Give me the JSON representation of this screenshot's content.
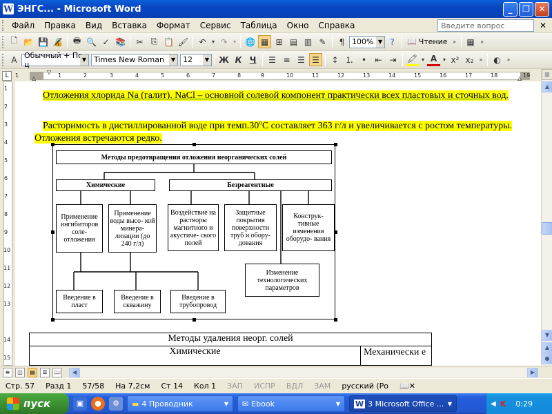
{
  "window": {
    "title": "ЭНГС... - Microsoft Word"
  },
  "menu": {
    "items": [
      "Файл",
      "Правка",
      "Вид",
      "Вставка",
      "Формат",
      "Сервис",
      "Таблица",
      "Окно",
      "Справка"
    ],
    "ask_placeholder": "Введите вопрос"
  },
  "toolbar_standard": {
    "zoom": "100%",
    "read_label": "Чтение"
  },
  "toolbar_format": {
    "style": "Обычный + По ц",
    "font": "Times New Roman",
    "size": "12",
    "bold": "Ж",
    "italic": "К",
    "underline": "Ч"
  },
  "ruler": {
    "ticks": [
      "1",
      "2",
      "1",
      "2",
      "3",
      "4",
      "5",
      "6",
      "7",
      "8",
      "9",
      "10",
      "11",
      "12",
      "13",
      "14",
      "15",
      "16",
      "17",
      "18",
      "19"
    ]
  },
  "vruler": {
    "ticks": [
      "1",
      "2",
      "3",
      "4",
      "5",
      "6",
      "7",
      "8",
      "9",
      "10",
      "11",
      "12",
      "13",
      "14",
      "15"
    ]
  },
  "document": {
    "para1": "Отложения хлорида Na (галит). NaCl – основной солевой компонент практически всех пластовых и сточных вод.",
    "para2_a": "Расторимость в дистиллированной воде при темп.30",
    "para2_sup": "o",
    "para2_b": "C составляет 363 г/л и увеличивается с ростом температуры. Отложения встречаются редко.",
    "figure": {
      "title": "Методы предотвращения отложения неорганических солей",
      "chem": "Химические",
      "nonreagent": "Безреагентные",
      "n1": "Применение ингибиторов соле- отложения",
      "n2": "Применение воды высо- кой минера- лизации (до 240 г/л)",
      "n3": "Воздействие на растворы магнитного и акустиче- ского полей",
      "n4": "Защитные покрытия поверхности труб и обору- дования",
      "n5": "Конструк- тивные изменения оборудо- вания",
      "n6": "Изменение технологических параметров",
      "n7": "Введение в пласт",
      "n8": "Введение в скважину",
      "n9": "Введение в трубопровод"
    },
    "table": {
      "header": "Методы удаления неорг. солей",
      "col1": "Химические",
      "col2": "Механически е"
    }
  },
  "statusbar": {
    "page": "Стр. 57",
    "section": "Разд 1",
    "pages": "57/58",
    "at": "На 7,2см",
    "line": "Ст 14",
    "col": "Кол 1",
    "rec": "ЗАП",
    "trk": "ИСПР",
    "ext": "ВДЛ",
    "ovr": "ЗАМ",
    "lang": "русский (Ро"
  },
  "taskbar": {
    "start": "пуск",
    "tasks": [
      "4 Проводник",
      "Ebook",
      "3 Microsoft Office ..."
    ],
    "clock": "0:29"
  }
}
